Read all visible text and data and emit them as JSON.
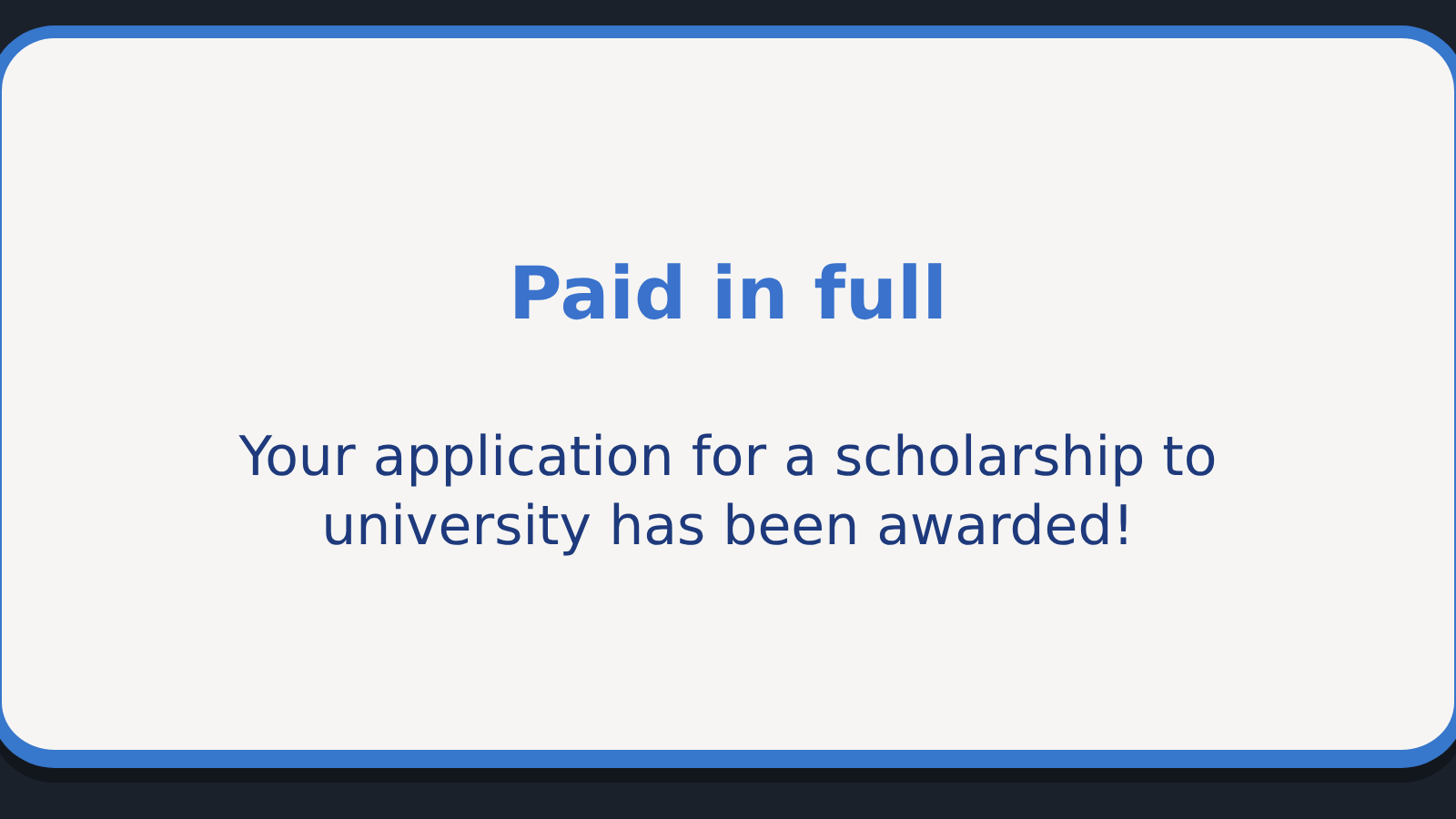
{
  "popup": {
    "title": "Paid in full",
    "message": "Your application for a scholarship to university has been awarded!"
  }
}
